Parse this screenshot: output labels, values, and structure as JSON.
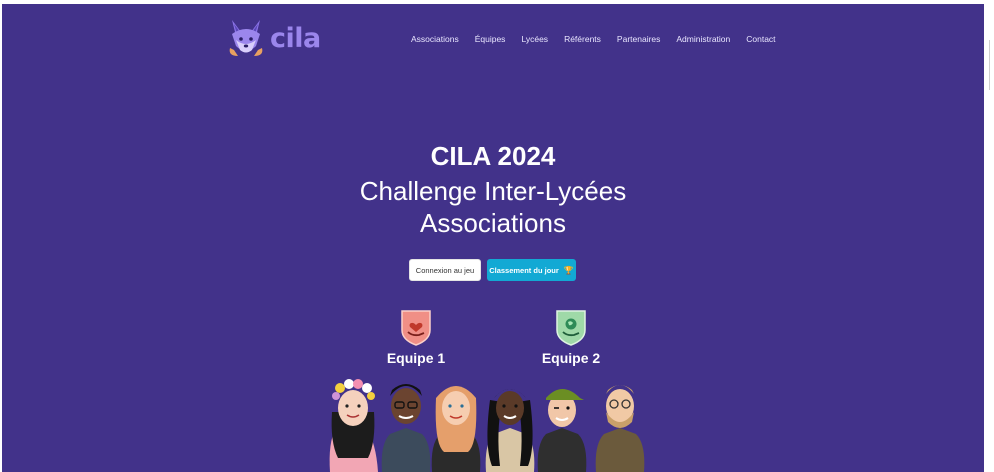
{
  "brand": {
    "name": "cila"
  },
  "nav": [
    {
      "label": "Associations"
    },
    {
      "label": "Équipes"
    },
    {
      "label": "Lycées"
    },
    {
      "label": "Référents"
    },
    {
      "label": "Partenaires"
    },
    {
      "label": "Administration"
    },
    {
      "label": "Contact"
    }
  ],
  "hero": {
    "title": "CILA 2024",
    "subtitle_line1": "Challenge Inter-Lycées",
    "subtitle_line2": "Associations"
  },
  "buttons": {
    "login": "Connexion au jeu",
    "ranking": "Classement du jour",
    "ranking_icon": "trophy-icon"
  },
  "teams": [
    {
      "label": "Equipe 1",
      "badge_color": "#f08f86",
      "icon": "heart-hand-icon"
    },
    {
      "label": "Equipe 2",
      "badge_color": "#9fd9a8",
      "icon": "globe-hand-icon"
    }
  ],
  "colors": {
    "background": "#42328a",
    "accent": "#12a9d4",
    "logo": "#9b86ec"
  }
}
